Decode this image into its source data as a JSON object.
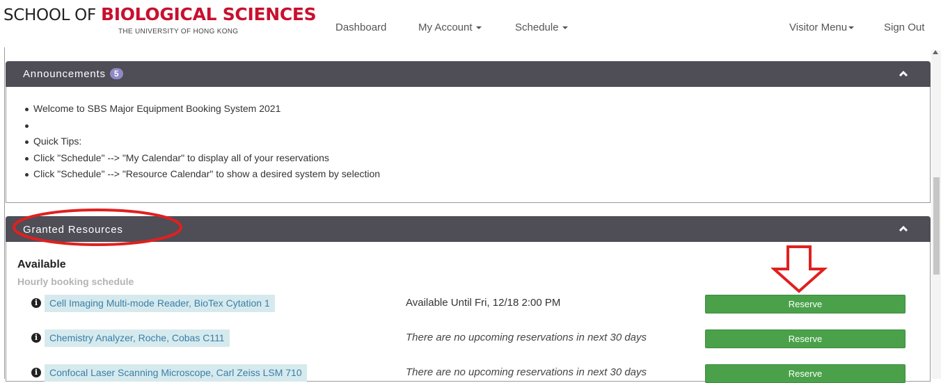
{
  "header": {
    "logo": {
      "line1_part1": "SCHOOL OF ",
      "line1_part2": "BIOLOGICAL SCIENCES",
      "line2": "THE UNIVERSITY OF HONG KONG"
    },
    "nav": {
      "dashboard": "Dashboard",
      "my_account": "My Account",
      "schedule": "Schedule",
      "visitor_menu": "Visitor Menu",
      "sign_out": "Sign Out"
    }
  },
  "announcements": {
    "title": "Announcements",
    "count": "5",
    "items": [
      "Welcome to SBS Major Equipment Booking System 2021",
      "",
      "Quick Tips:",
      "Click \"Schedule\" --> \"My Calendar\" to display all of your reservations",
      "Click \"Schedule\" --> \"Resource Calendar\" to show a desired system by selection"
    ]
  },
  "granted": {
    "title": "Granted Resources",
    "section_heading": "Available",
    "section_subheading": "Hourly booking schedule",
    "resources": [
      {
        "name": "Cell Imaging Multi-mode Reader, BioTex Cytation 1",
        "status": "Available Until Fri, 12/18 2:00 PM",
        "action": "Reserve"
      },
      {
        "name": "Chemistry Analyzer, Roche, Cobas C111",
        "status": "There are no upcoming reservations in next 30 days",
        "action": "Reserve"
      },
      {
        "name": "Confocal Laser Scanning Microscope, Carl Zeiss LSM 710",
        "status": "There are no upcoming reservations in next 30 days",
        "action": "Reserve"
      }
    ]
  },
  "colors": {
    "panel_header": "#4f4d56",
    "badge": "#8f8ac6",
    "reserve_button": "#4aa14a",
    "resource_link_bg": "#d6eaee",
    "annotation_red": "#e02020"
  }
}
